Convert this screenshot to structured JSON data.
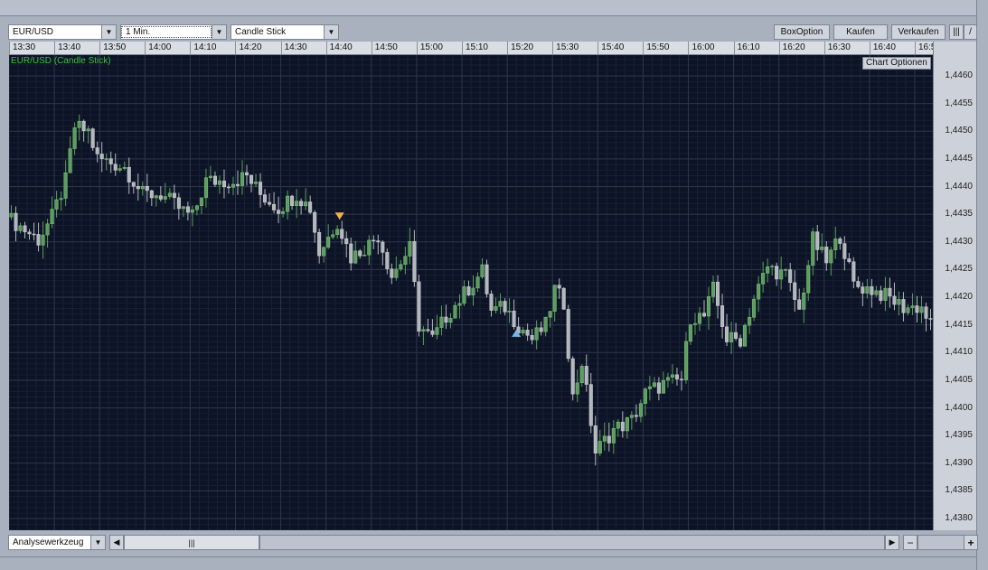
{
  "toolbar": {
    "symbol": "EUR/USD",
    "interval": "1 Min.",
    "chart_type": "Candle Stick",
    "box_option": "BoxOption",
    "buy": "Kaufen",
    "sell": "Verkaufen"
  },
  "chart": {
    "title": "EUR/USD (Candle Stick)",
    "options_label": "Chart Optionen",
    "time_labels": [
      "13:30",
      "13:40",
      "13:50",
      "14:00",
      "14:10",
      "14:20",
      "14:30",
      "14:40",
      "14:50",
      "15:00",
      "15:10",
      "15:20",
      "15:30",
      "15:40",
      "15:50",
      "16:00",
      "16:10",
      "16:20",
      "16:30",
      "16:40",
      "16:5"
    ],
    "price_labels": [
      "1,4460",
      "1,4455",
      "1,4450",
      "1,4445",
      "1,4440",
      "1,4435",
      "1,4430",
      "1,4425",
      "1,4420",
      "1,4415",
      "1,4410",
      "1,4405",
      "1,4400",
      "1,4395",
      "1,4390",
      "1,4385",
      "1,4380"
    ],
    "price_range": [
      1.438,
      1.446
    ],
    "minutes_shown": 204,
    "up_color": "#5c9e5c",
    "down_color": "#b4b8bd",
    "sell_marker_color": "#f2b04a",
    "buy_marker_color": "#6cb8e8",
    "waypoints": [
      [
        0,
        1.44345
      ],
      [
        7,
        1.44304
      ],
      [
        10,
        1.44345
      ],
      [
        13,
        1.4441
      ],
      [
        15,
        1.44508
      ],
      [
        18,
        1.445
      ],
      [
        20,
        1.44451
      ],
      [
        26,
        1.44435
      ],
      [
        30,
        1.44386
      ],
      [
        34,
        1.44386
      ],
      [
        38,
        1.44361
      ],
      [
        41,
        1.44345
      ],
      [
        44,
        1.4441
      ],
      [
        50,
        1.4441
      ],
      [
        53,
        1.44419
      ],
      [
        56,
        1.44386
      ],
      [
        60,
        1.44361
      ],
      [
        64,
        1.44386
      ],
      [
        67,
        1.44361
      ],
      [
        69,
        1.4428
      ],
      [
        73,
        1.44337
      ],
      [
        76,
        1.44272
      ],
      [
        80,
        1.44296
      ],
      [
        82,
        1.44312
      ],
      [
        85,
        1.44239
      ],
      [
        89,
        1.44288
      ],
      [
        91,
        1.44149
      ],
      [
        94,
        1.44124
      ],
      [
        97,
        1.44165
      ],
      [
        101,
        1.44206
      ],
      [
        105,
        1.44247
      ],
      [
        107,
        1.44174
      ],
      [
        110,
        1.44182
      ],
      [
        113,
        1.44149
      ],
      [
        116,
        1.44124
      ],
      [
        119,
        1.44149
      ],
      [
        121,
        1.44214
      ],
      [
        123,
        1.4419
      ],
      [
        125,
        1.44018
      ],
      [
        127,
        1.44084
      ],
      [
        130,
        1.4392
      ],
      [
        134,
        1.43961
      ],
      [
        138,
        1.43977
      ],
      [
        141,
        1.44026
      ],
      [
        145,
        1.44043
      ],
      [
        149,
        1.44051
      ],
      [
        151,
        1.44165
      ],
      [
        154,
        1.44165
      ],
      [
        156,
        1.44214
      ],
      [
        159,
        1.44124
      ],
      [
        162,
        1.44124
      ],
      [
        165,
        1.44198
      ],
      [
        168,
        1.44255
      ],
      [
        172,
        1.44239
      ],
      [
        175,
        1.44174
      ],
      [
        178,
        1.44304
      ],
      [
        181,
        1.44263
      ],
      [
        184,
        1.44312
      ],
      [
        187,
        1.44222
      ],
      [
        191,
        1.44214
      ],
      [
        195,
        1.44198
      ],
      [
        198,
        1.44182
      ],
      [
        202,
        1.44182
      ],
      [
        204,
        1.44149
      ]
    ],
    "markers": [
      {
        "type": "sell",
        "minute": 73,
        "price": 1.44345
      },
      {
        "type": "buy",
        "minute": 112,
        "price": 1.44135
      }
    ]
  },
  "bottom": {
    "tool": "Analysewerkzeug",
    "zoom_out": "−",
    "zoom_in": "+"
  }
}
